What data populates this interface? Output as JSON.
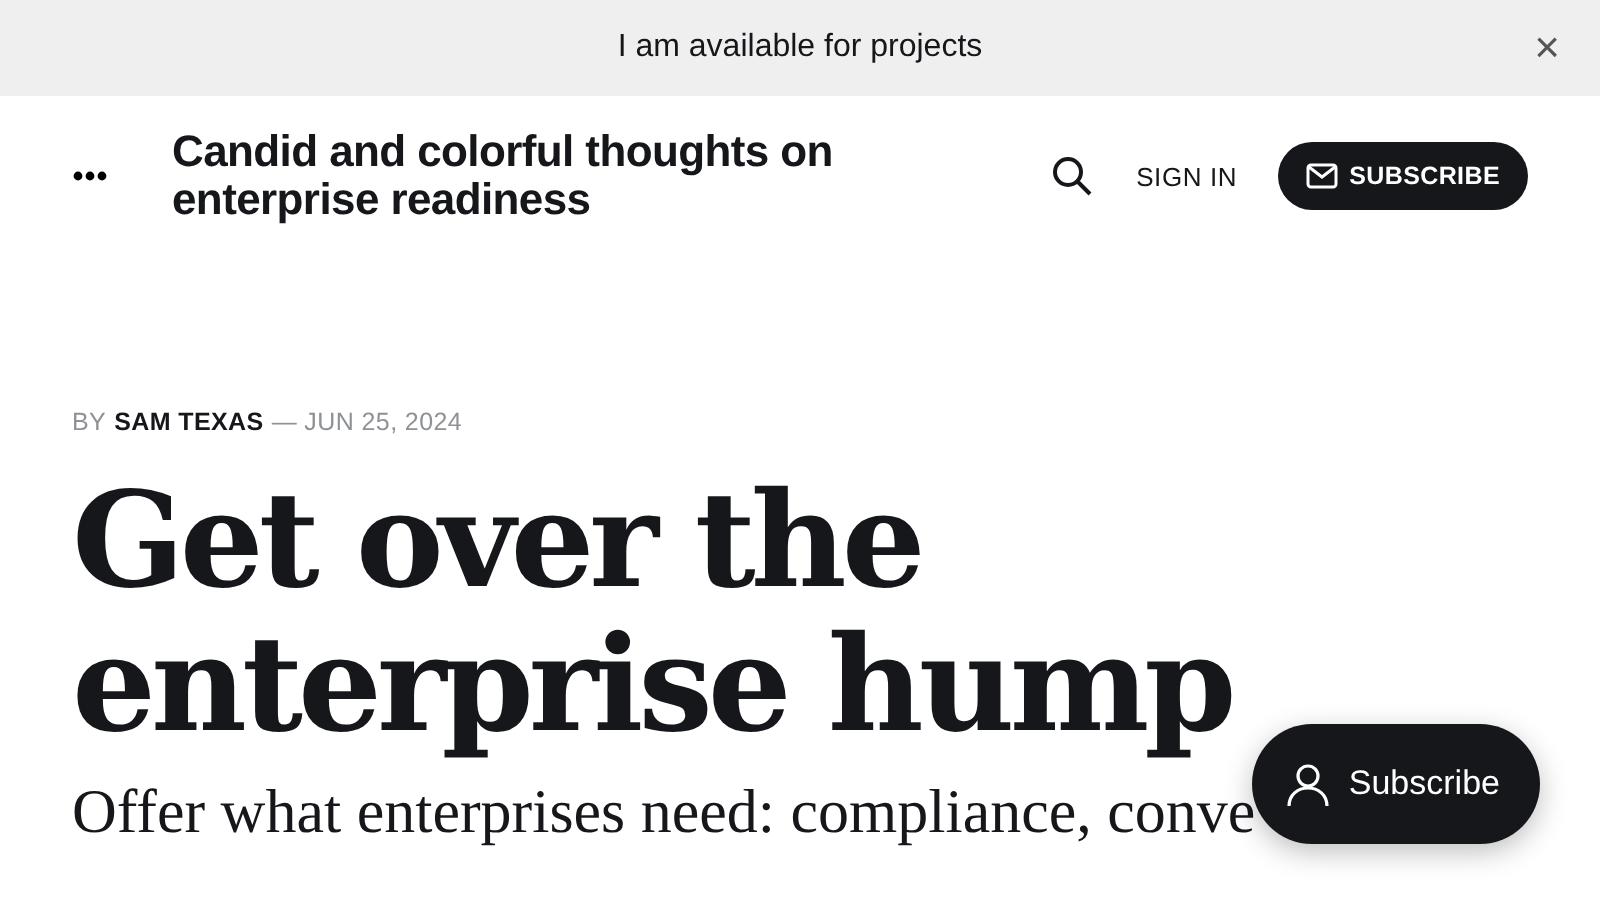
{
  "announcement": {
    "text": "I am available for projects",
    "close": "×"
  },
  "header": {
    "site_title": "Candid and colorful thoughts on enterprise readiness",
    "sign_in": "SIGN IN",
    "subscribe": "SUBSCRIBE"
  },
  "post": {
    "by": "BY",
    "author": "SAM TEXAS",
    "date": "— JUN 25, 2024",
    "title": "Get over the enterprise hump",
    "excerpt": "Offer what enterprises need: compliance, conve"
  },
  "floating_button": {
    "label": "Subscribe"
  }
}
